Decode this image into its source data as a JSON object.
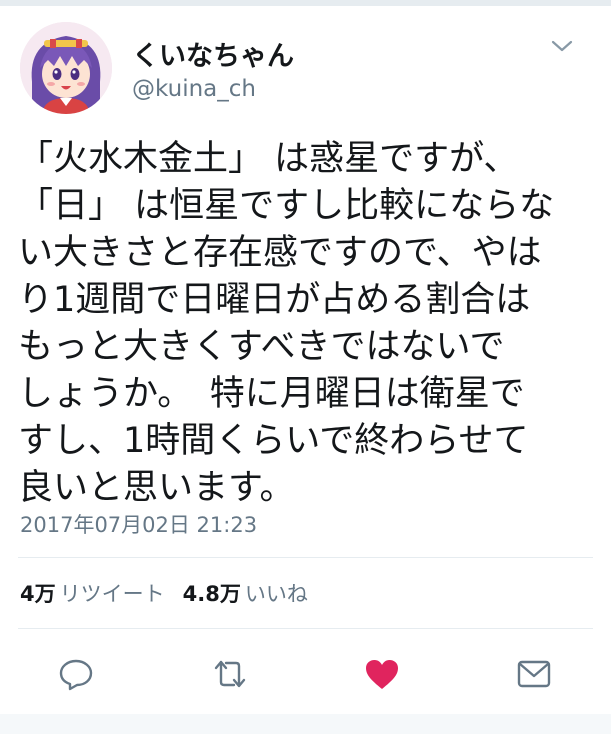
{
  "author": {
    "display_name": "くいなちゃん",
    "handle": "@kuina_ch",
    "avatar_icon": "character-avatar"
  },
  "menu": {
    "icon": "chevron-down-icon"
  },
  "tweet": {
    "lines": [
      "「火水木金土」 は惑星ですが、",
      "「日」 は恒星ですし比較にならな",
      "い大きさと存在感ですので、やは",
      "り1週間で日曜日が占める割合は",
      "もっと大きくすべきではないで",
      "しょうか。　特に月曜日は衛星で",
      "すし、1時間くらいで終わらせて",
      "良いと思います。"
    ],
    "timestamp": "2017年07月02日 21:23"
  },
  "stats": {
    "retweet_count": "4万",
    "retweet_label": "リツイート",
    "like_count": "4.8万",
    "like_label": "いいね"
  },
  "actions": [
    {
      "name": "reply",
      "icon": "reply-icon"
    },
    {
      "name": "retweet",
      "icon": "retweet-icon"
    },
    {
      "name": "like",
      "icon": "heart-icon",
      "active_color": "#e0245e"
    },
    {
      "name": "share",
      "icon": "mail-icon"
    }
  ],
  "colors": {
    "text": "#14171a",
    "secondary": "#657786",
    "border": "#e6ecf0",
    "like_active": "#e0245e"
  }
}
